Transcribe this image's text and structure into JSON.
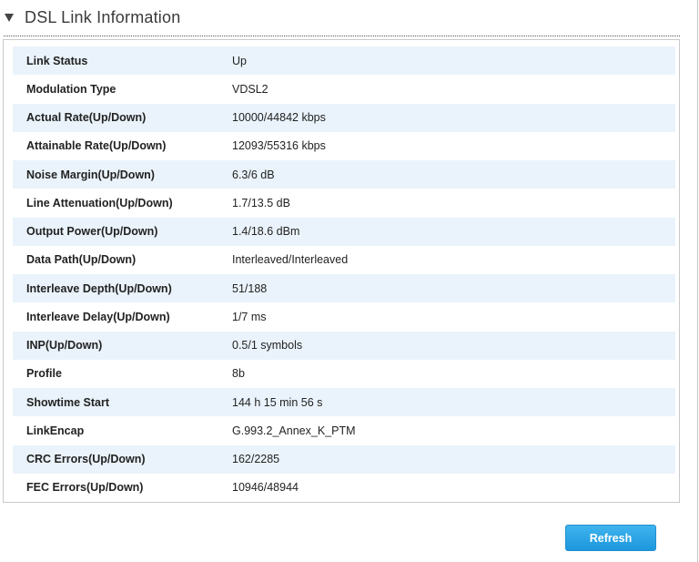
{
  "section": {
    "title": "DSL Link Information"
  },
  "rows": [
    {
      "label": "Link Status",
      "value": "Up"
    },
    {
      "label": "Modulation Type",
      "value": "VDSL2"
    },
    {
      "label": "Actual Rate(Up/Down)",
      "value": "10000/44842 kbps"
    },
    {
      "label": "Attainable Rate(Up/Down)",
      "value": "12093/55316 kbps"
    },
    {
      "label": "Noise Margin(Up/Down)",
      "value": "6.3/6 dB"
    },
    {
      "label": "Line Attenuation(Up/Down)",
      "value": "1.7/13.5 dB"
    },
    {
      "label": "Output Power(Up/Down)",
      "value": "1.4/18.6 dBm"
    },
    {
      "label": "Data Path(Up/Down)",
      "value": "Interleaved/Interleaved"
    },
    {
      "label": "Interleave Depth(Up/Down)",
      "value": "51/188"
    },
    {
      "label": "Interleave Delay(Up/Down)",
      "value": "1/7 ms"
    },
    {
      "label": "INP(Up/Down)",
      "value": "0.5/1 symbols"
    },
    {
      "label": "Profile",
      "value": "8b"
    },
    {
      "label": "Showtime Start",
      "value": "144 h 15 min 56 s"
    },
    {
      "label": "LinkEncap",
      "value": "G.993.2_Annex_K_PTM"
    },
    {
      "label": "CRC Errors(Up/Down)",
      "value": "162/2285"
    },
    {
      "label": "FEC Errors(Up/Down)",
      "value": "10946/48944"
    }
  ],
  "actions": {
    "refresh_label": "Refresh"
  },
  "colors": {
    "row_stripe": "#eaf3fb",
    "button": "#1c97dc"
  }
}
